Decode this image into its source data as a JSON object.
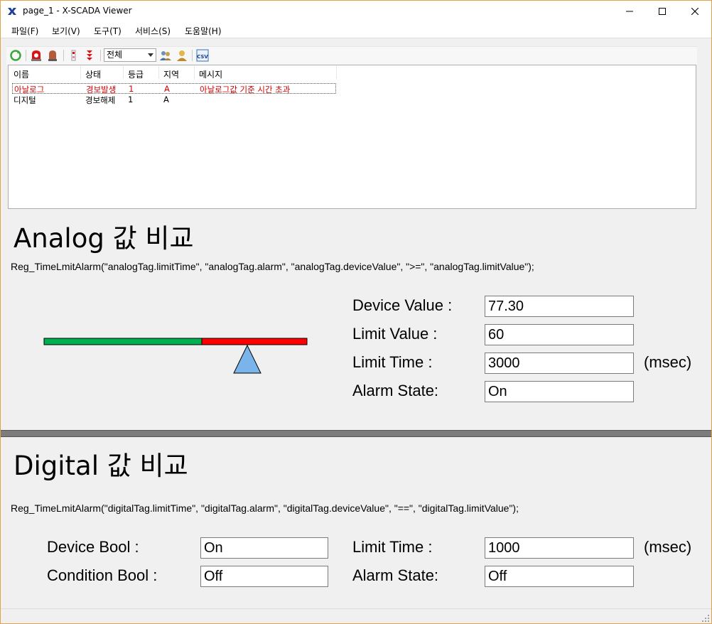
{
  "window": {
    "title": "page_1 - X-SCADA Viewer"
  },
  "menu": [
    "파일(F)",
    "보기(V)",
    "도구(T)",
    "서비스(S)",
    "도움말(H)"
  ],
  "toolbar": {
    "filter_value": "전체",
    "icons": [
      "refresh-icon",
      "alarm-ack-icon",
      "alarm-bell-icon",
      "alarm-filter-icon",
      "alarm-filter-all-icon",
      "user-group-icon",
      "user-icon",
      "csv-export-icon"
    ],
    "csv_label": "CSV"
  },
  "alarm_list": {
    "columns": [
      "이름",
      "상태",
      "등급",
      "지역",
      "메시지"
    ],
    "rows": [
      {
        "name": "아날로그",
        "state": "경보발생",
        "level": "1",
        "area": "A",
        "message": "아날로그값 기준 시간 초과",
        "color": "#d60000"
      },
      {
        "name": "디지털",
        "state": "경보해제",
        "level": "1",
        "area": "A",
        "message": "",
        "color": "#000000"
      }
    ]
  },
  "analog": {
    "title": "Analog 값 비교",
    "call": "Reg_TimeLmitAlarm(\"analogTag.limitTime\", \"analogTag.alarm\", \"analogTag.deviceValue\", \">=\", \"analogTag.limitValue\");",
    "device_value_label": "Device Value :",
    "device_value": "77.30",
    "limit_value_label": "Limit Value :",
    "limit_value": "60",
    "limit_time_label": "Limit Time :",
    "limit_time": "3000",
    "unit": "(msec)",
    "alarm_state_label": "Alarm State:",
    "alarm_state": "On",
    "balance": {
      "green_color": "#00b050",
      "red_color": "#ff0000",
      "pivot_color": "#7ab4ea"
    }
  },
  "digital": {
    "title": "Digital 값 비교",
    "call": "Reg_TimeLmitAlarm(\"digitalTag.limitTime\", \"digitalTag.alarm\", \"digitalTag.deviceValue\", \"==\", \"digitalTag.limitValue\");",
    "device_bool_label": "Device Bool :",
    "device_bool": "On",
    "condition_bool_label": "Condition Bool :",
    "condition_bool": "Off",
    "limit_time_label": "Limit Time :",
    "limit_time": "1000",
    "unit": "(msec)",
    "alarm_state_label": "Alarm State:",
    "alarm_state": "Off"
  }
}
